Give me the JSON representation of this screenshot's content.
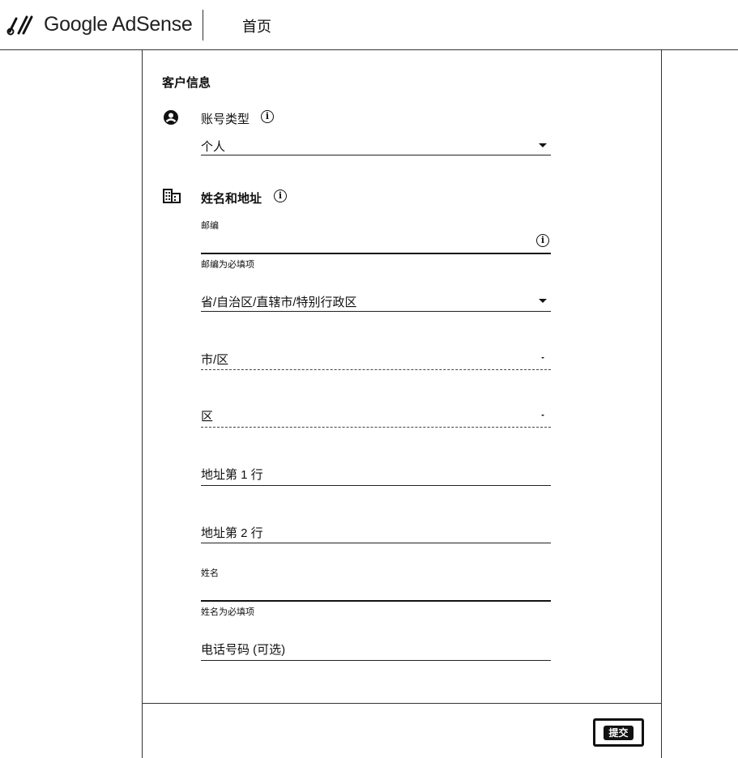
{
  "header": {
    "brand": "Google AdSense",
    "nav_home": "首页"
  },
  "form": {
    "section_title": "客户信息",
    "account_type": {
      "label": "账号类型",
      "value": "个人"
    },
    "name_address": {
      "label": "姓名和地址"
    },
    "postal_code": {
      "label": "邮编",
      "error": "邮编为必填项"
    },
    "province": {
      "placeholder": "省/自治区/直辖市/特别行政区"
    },
    "city": {
      "placeholder": "市/区"
    },
    "district": {
      "placeholder": "区"
    },
    "address1": {
      "placeholder": "地址第 1 行"
    },
    "address2": {
      "placeholder": "地址第 2 行"
    },
    "name": {
      "label": "姓名",
      "error": "姓名为必填项"
    },
    "phone": {
      "placeholder": "电话号码 (可选)"
    }
  },
  "footer": {
    "submit_label": "提交"
  },
  "icons": {
    "logo": "adsense-logo-icon",
    "account": "account-circle-icon",
    "business": "business-building-icon",
    "info": "info-icon",
    "dropdown": "arrow-drop-down-icon"
  }
}
